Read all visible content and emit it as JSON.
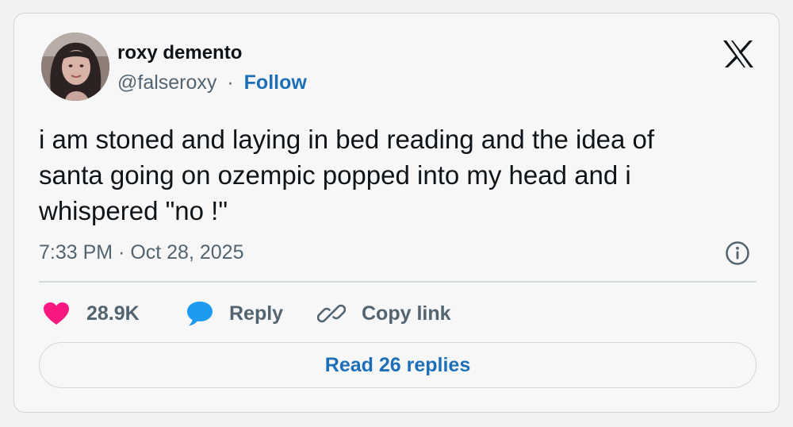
{
  "author": {
    "name": "roxy demento",
    "handle": "@falseroxy",
    "separator": "·",
    "follow_label": "Follow"
  },
  "tweet": {
    "lines": [
      "i am stoned and laying in bed reading and the idea of",
      "santa going on ozempic popped into my head and i",
      "whispered \"no !\""
    ],
    "timestamp": "7:33 PM · Oct 28, 2025"
  },
  "actions": {
    "like_count": "28.9K",
    "reply_label": "Reply",
    "copy_link_label": "Copy link"
  },
  "read_replies_label": "Read 26 replies",
  "icons": {
    "brand": "x-logo-icon",
    "info": "info-icon",
    "like": "heart-icon",
    "reply": "speech-bubble-icon",
    "copy": "link-icon"
  },
  "colors": {
    "like": "#f91880",
    "reply": "#1d9bf0",
    "link": "#1d70b8",
    "muted": "#536471"
  }
}
